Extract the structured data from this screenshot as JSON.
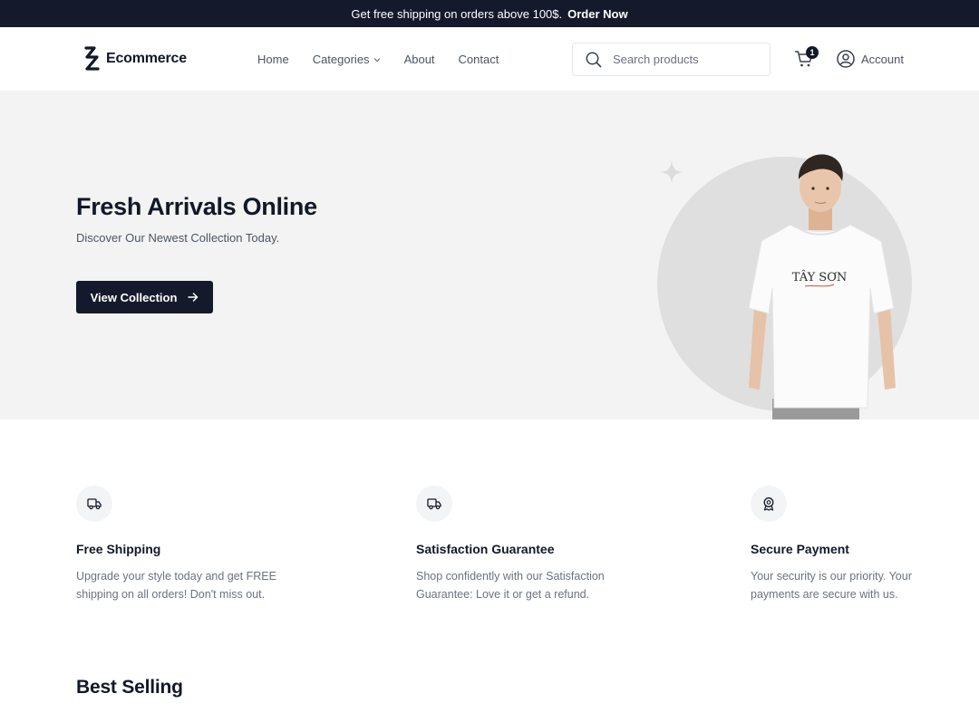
{
  "announcement": {
    "text": "Get free shipping on orders above 100$.",
    "cta": "Order Now"
  },
  "header": {
    "logo_text": "Ecommerce",
    "nav": {
      "home": "Home",
      "categories": "Categories",
      "about": "About",
      "contact": "Contact"
    },
    "search_placeholder": "Search products",
    "cart_count": "1",
    "account_label": "Account"
  },
  "hero": {
    "title": "Fresh Arrivals Online",
    "subtitle": "Discover Our Newest Collection Today.",
    "button_label": "View Collection",
    "shirt_brand": "TÂY SƠN",
    "colors": {
      "background": "#f3f3f3",
      "circle": "#dfdfdf",
      "button": "#141a2b"
    }
  },
  "features": [
    {
      "icon": "truck-icon",
      "title": "Free Shipping",
      "description": "Upgrade your style today and get FREE shipping on all orders! Don't miss out."
    },
    {
      "icon": "truck-icon",
      "title": "Satisfaction Guarantee",
      "description": "Shop confidently with our Satisfaction Guarantee: Love it or get a refund."
    },
    {
      "icon": "award-badge-icon",
      "title": "Secure Payment",
      "description": "Your security is our priority. Your payments are secure with us."
    }
  ],
  "best_selling_title": "Best Selling"
}
